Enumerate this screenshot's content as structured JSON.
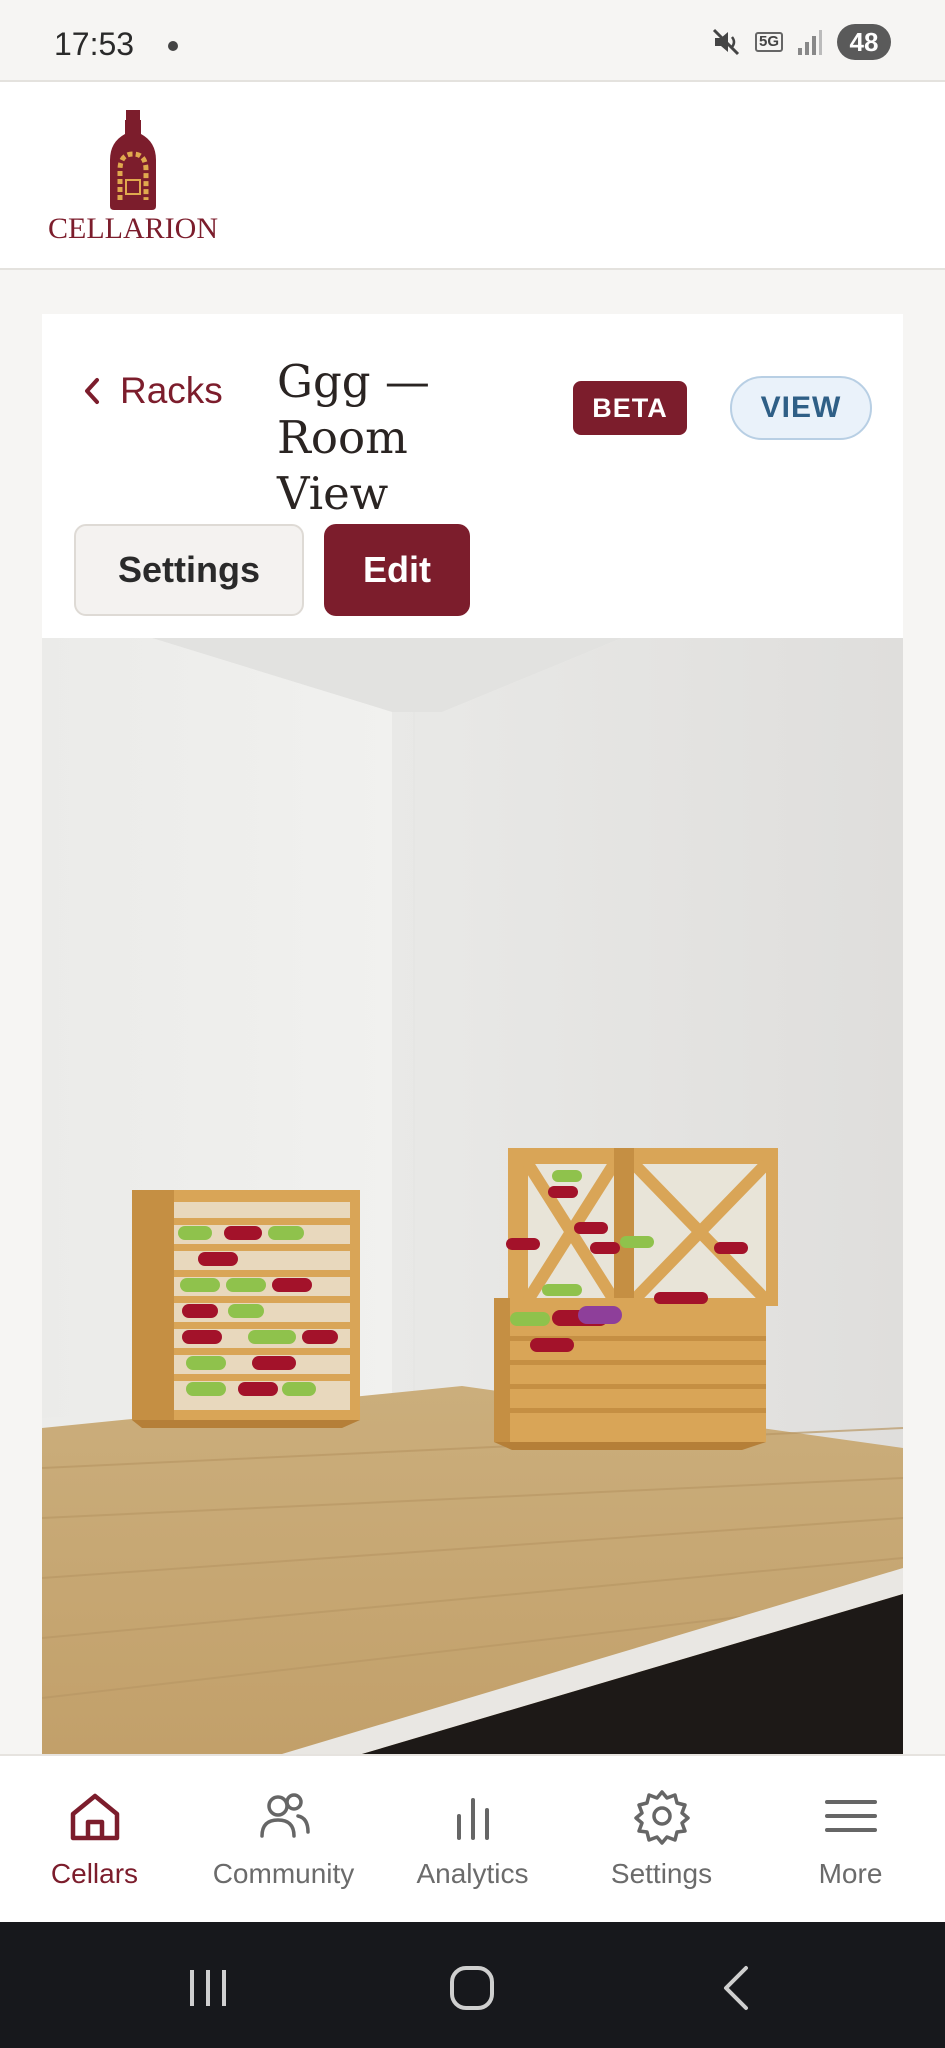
{
  "status_bar": {
    "time": "17:53",
    "network": "5G",
    "battery": "48"
  },
  "header": {
    "logo_text": "CELLARION"
  },
  "page": {
    "back_label": "Racks",
    "title": "Ggg — Room View",
    "badge": "BETA",
    "view_label": "VIEW",
    "settings_button": "Settings",
    "edit_button": "Edit"
  },
  "bottom_nav": {
    "items": [
      {
        "label": "Cellars",
        "icon": "home-icon",
        "active": true
      },
      {
        "label": "Community",
        "icon": "users-icon",
        "active": false
      },
      {
        "label": "Analytics",
        "icon": "bar-chart-icon",
        "active": false
      },
      {
        "label": "Settings",
        "icon": "gear-icon",
        "active": false
      },
      {
        "label": "More",
        "icon": "menu-icon",
        "active": false
      }
    ]
  },
  "colors": {
    "brand": "#7c1d2c",
    "view_button": "#2f5f86",
    "wood": "#d9a557",
    "floor": "#c9a56f"
  }
}
